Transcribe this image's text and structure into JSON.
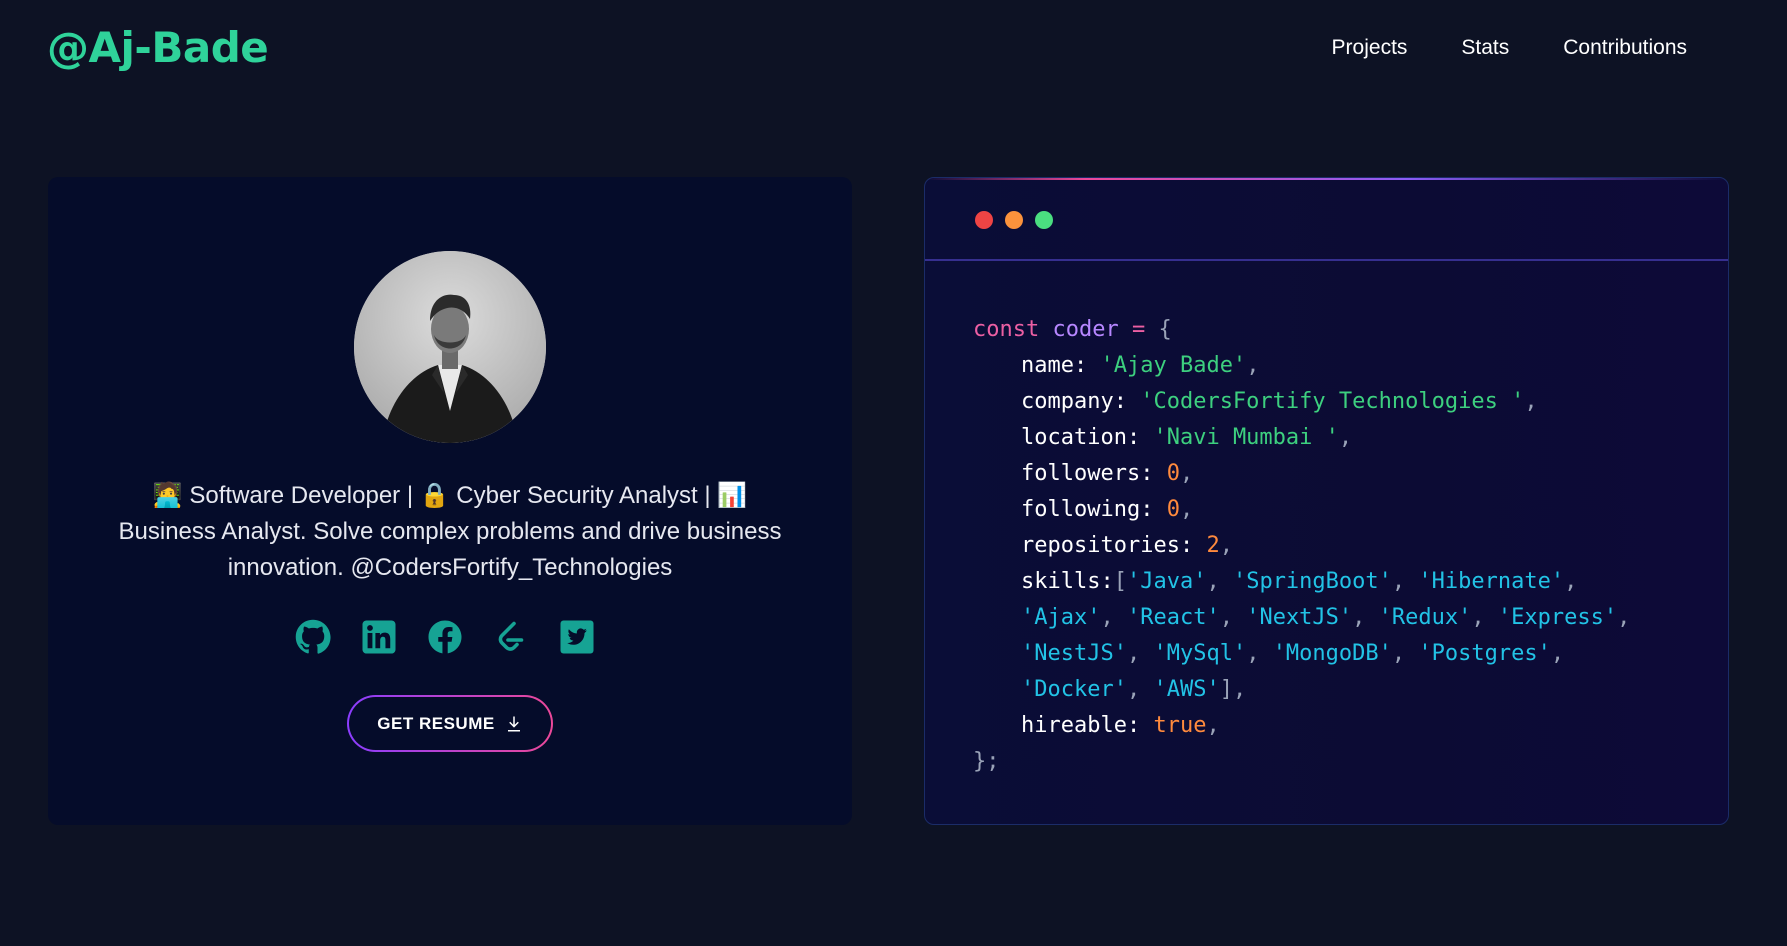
{
  "header": {
    "brand": "@Aj-Bade",
    "nav": [
      {
        "label": "Projects"
      },
      {
        "label": "Stats"
      },
      {
        "label": "Contributions"
      }
    ]
  },
  "profile": {
    "bio": "🧑‍💻 Software Developer | 🔒 Cyber Security Analyst | 📊 Business Analyst. Solve complex problems and drive business innovation. @CodersFortify_Technologies",
    "socials": [
      "github-icon",
      "linkedin-icon",
      "facebook-icon",
      "leetcode-icon",
      "twitter-icon"
    ],
    "resume_label": "GET RESUME"
  },
  "code": {
    "decl_keyword": "const",
    "var_name": "coder",
    "name_key": "name:",
    "name_value": "'Ajay Bade'",
    "company_key": "company:",
    "company_value": "'CodersFortify Technologies '",
    "location_key": "location:",
    "location_value": "'Navi Mumbai '",
    "followers_key": "followers:",
    "followers_value": "0",
    "following_key": "following:",
    "following_value": "0",
    "repositories_key": "repositories:",
    "repositories_value": "2",
    "skills_key": "skills:",
    "skills": [
      "'Java'",
      "'SpringBoot'",
      "'Hibernate'",
      "'Ajax'",
      "'React'",
      "'NextJS'",
      "'Redux'",
      "'Express'",
      "'NestJS'",
      "'MySql'",
      "'MongoDB'",
      "'Postgres'",
      "'Docker'",
      "'AWS'"
    ],
    "hireable_key": "hireable:",
    "hireable_value": "true"
  },
  "colors": {
    "accent": "#16f2b3",
    "background": "#0d1224",
    "card": "#050c2a",
    "icon": "#16a394",
    "dot_red": "#ef4444",
    "dot_orange": "#fb923c",
    "dot_green": "#4ade80"
  }
}
